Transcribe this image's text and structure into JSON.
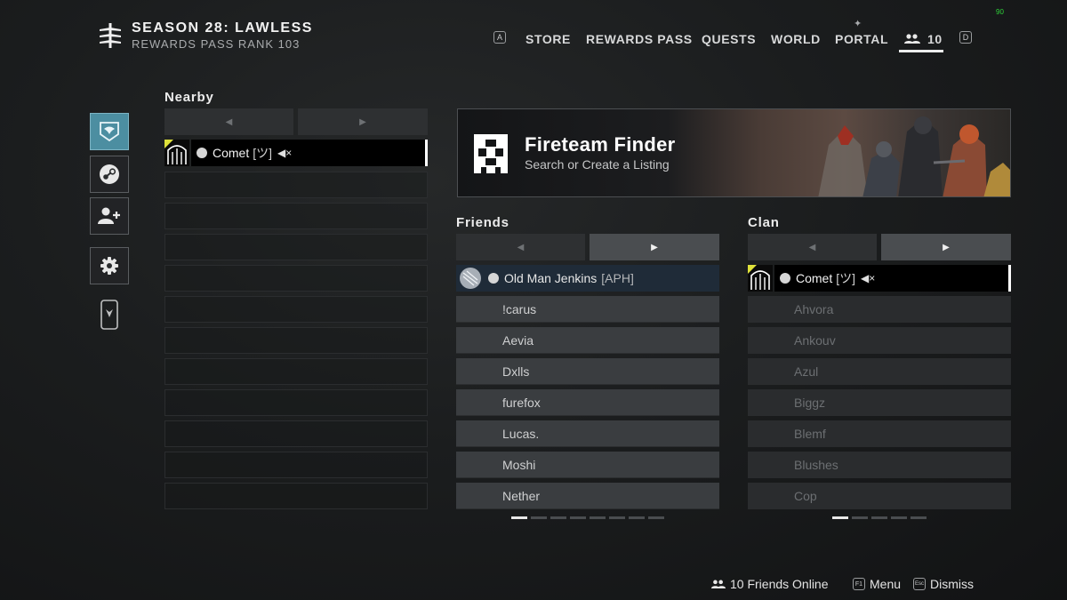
{
  "header": {
    "season_title": "SEASON 28: LAWLESS",
    "rank_text": "REWARDS PASS RANK 103",
    "fps": "90"
  },
  "nav": {
    "left_key": "A",
    "items": [
      "STORE",
      "REWARDS PASS",
      "QUESTS",
      "WORLD",
      "PORTAL"
    ],
    "friends_count": "10",
    "right_key": "D"
  },
  "side_rail": {
    "icons": [
      "clan-banner-icon",
      "steam-icon",
      "add-friend-icon",
      "settings-gear-icon",
      "companion-phone-icon"
    ]
  },
  "nearby": {
    "title": "Nearby",
    "player": {
      "name": "Comet",
      "tag": "[ツ]"
    }
  },
  "banner": {
    "title": "Fireteam Finder",
    "subtitle": "Search or Create a Listing"
  },
  "friends": {
    "title": "Friends",
    "highlighted": {
      "name": "Old Man Jenkins",
      "tag": "[APH]"
    },
    "list": [
      "!carus",
      "Aevia",
      "Dxlls",
      "furefox",
      "Lucas.",
      "Moshi",
      "Nether"
    ]
  },
  "clan": {
    "title": "Clan",
    "player": {
      "name": "Comet",
      "tag": "[ツ]"
    },
    "list": [
      "Ahvora",
      "Ankouv",
      "Azul",
      "Biggz",
      "Blemf",
      "Blushes",
      "Cop"
    ]
  },
  "footer": {
    "online": "10 Friends Online",
    "menu_key": "F1",
    "menu_label": "Menu",
    "dismiss_key": "Esc",
    "dismiss_label": "Dismiss"
  },
  "colors": {
    "background": "#1b1d1e",
    "active_rail": "#4c8ea1",
    "highlight_row": "#1f2b38",
    "fps_green": "#2ed23a"
  }
}
